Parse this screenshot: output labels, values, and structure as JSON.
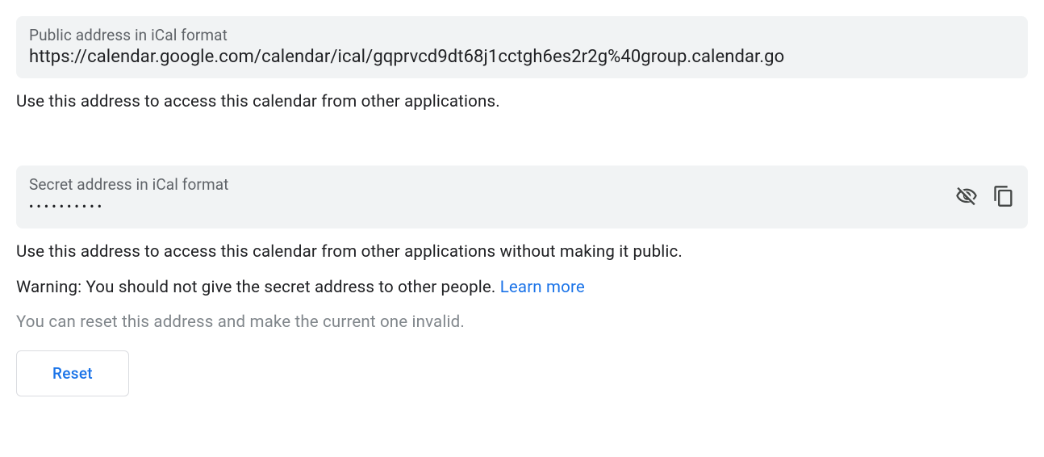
{
  "public": {
    "label": "Public address in iCal format",
    "value": "https://calendar.google.com/calendar/ical/gqprvcd9dt68j1cctgh6es2r2g%40group.calendar.go",
    "helper": "Use this address to access this calendar from other applications."
  },
  "secret": {
    "label": "Secret address in iCal format",
    "value_masked": "••••••••••",
    "helper": "Use this address to access this calendar from other applications without making it public.",
    "warning_prefix": "Warning: You should not give the secret address to other people. ",
    "learn_more": "Learn more",
    "reset_note": "You can reset this address and make the current one invalid.",
    "reset_label": "Reset"
  }
}
